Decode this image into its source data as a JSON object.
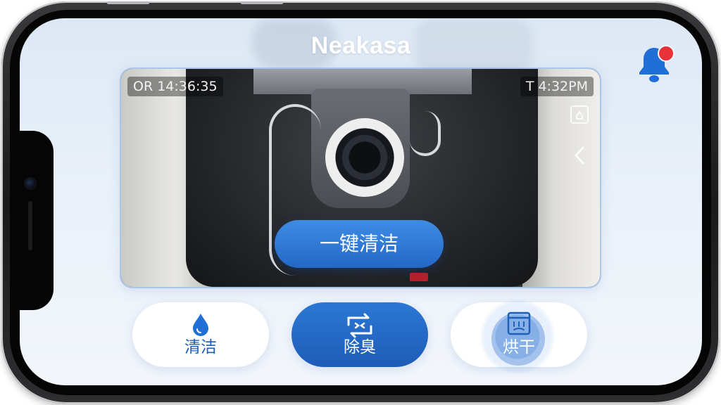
{
  "app": {
    "title": "Neakasa"
  },
  "notifications": {
    "has_unread": true
  },
  "camera": {
    "timestamp_left": "OR 14:36:35",
    "timestamp_right": "T 4:32PM"
  },
  "actions": {
    "one_click_clean": "一键清洁"
  },
  "modes": [
    {
      "label": "清洁",
      "icon": "water-drop-icon",
      "active": false
    },
    {
      "label": "除臭",
      "icon": "deodorize-arrows-icon",
      "active": true
    },
    {
      "label": "烘干",
      "icon": "dryer-icon",
      "active": false
    }
  ],
  "colors": {
    "accent": "#2468c7",
    "badge": "#e8323a"
  }
}
